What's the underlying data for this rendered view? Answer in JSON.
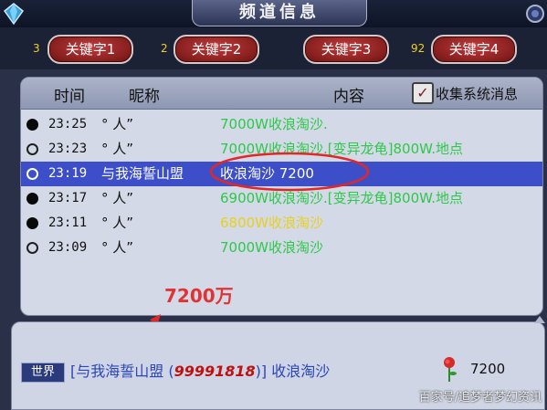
{
  "window": {
    "title": "频道信息"
  },
  "keywords": [
    {
      "count": "3",
      "label": "关键字1"
    },
    {
      "count": "2",
      "label": "关键字2"
    },
    {
      "count": "",
      "label": "关键字3"
    },
    {
      "count": "92",
      "label": "关键字4"
    }
  ],
  "header": {
    "time": "时间",
    "nickname": "昵称",
    "content": "内容",
    "collect_checked": true,
    "collect_label": "收集系统消息"
  },
  "rows": [
    {
      "dot": "filled",
      "time": "23:25",
      "nick": "° 人”",
      "selected": false,
      "segments": [
        {
          "text": "7000W收浪淘沙.",
          "color": "#2ec84a"
        }
      ]
    },
    {
      "dot": "empty",
      "time": "23:23",
      "nick": "° 人”",
      "selected": false,
      "segments": [
        {
          "text": "7000W收浪淘沙.",
          "color": "#2ec84a"
        },
        {
          "text": "[变异龙龟]",
          "color": "#2ec84a"
        },
        {
          "text": "800W.地点",
          "color": "#2ec84a"
        }
      ]
    },
    {
      "dot": "empty",
      "time": "23:19",
      "nick": "与我海誓山盟",
      "selected": true,
      "segments": [
        {
          "text": "收浪淘沙  7200",
          "color": "#ffffff"
        }
      ]
    },
    {
      "dot": "filled",
      "time": "23:17",
      "nick": "° 人”",
      "selected": false,
      "segments": [
        {
          "text": "6900W收浪淘沙.",
          "color": "#2ec84a"
        },
        {
          "text": "[变异龙龟]",
          "color": "#2ec84a"
        },
        {
          "text": "800W.地点",
          "color": "#2ec84a"
        }
      ]
    },
    {
      "dot": "filled",
      "time": "23:11",
      "nick": "° 人”",
      "selected": false,
      "segments": [
        {
          "text": "6800W收浪淘沙",
          "color": "#e8d020"
        }
      ]
    },
    {
      "dot": "empty",
      "time": "23:09",
      "nick": "° 人”",
      "selected": false,
      "segments": [
        {
          "text": "7000W收浪淘沙",
          "color": "#2ec84a"
        }
      ]
    }
  ],
  "annotation": {
    "text": "7200万",
    "color": "#e03434"
  },
  "world": {
    "badge": "世界",
    "prefix": "[与我海誓山盟 (",
    "number": "99991818",
    "suffix": ")] 收浪淘沙",
    "price": "7200"
  },
  "watermark": "百家号/追梦者梦幻资讯"
}
